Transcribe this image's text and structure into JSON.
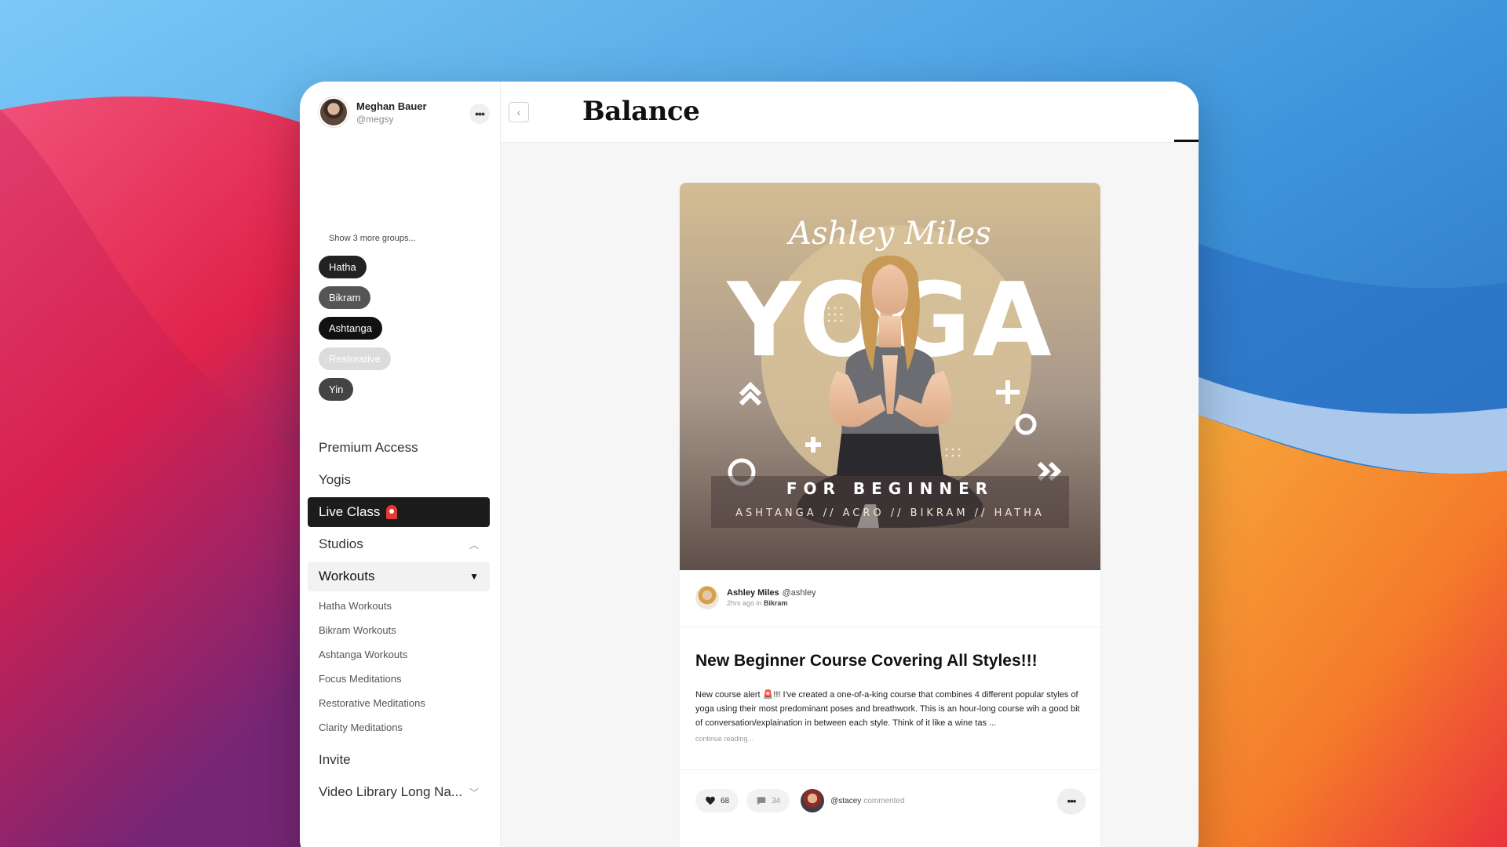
{
  "user": {
    "name": "Meghan Bauer",
    "handle": "@megsy"
  },
  "sidebar": {
    "more_label": "•••",
    "show_more_groups": "Show 3 more groups...",
    "groups": [
      "Hatha",
      "Bikram",
      "Ashtanga",
      "Restorative",
      "Yin"
    ],
    "nav": {
      "premium": "Premium Access",
      "yogis": "Yogis",
      "live_class": "Live Class",
      "studios": "Studios",
      "workouts": "Workouts",
      "sub_items": [
        "Hatha Workouts",
        "Bikram Workouts",
        "Ashtanga Workouts",
        "Focus Meditations",
        "Restorative Meditations",
        "Clarity Meditations"
      ],
      "invite": "Invite",
      "video_library": "Video Library Long Na..."
    }
  },
  "topbar": {
    "brand": "Balance",
    "icons": [
      "plus-circle-icon",
      "home-icon",
      "explore-icon",
      "notes-icon",
      "chat-icon",
      "user-avatar"
    ]
  },
  "post": {
    "image_text": {
      "script_name": "Ashley Miles",
      "headline": "YOGA",
      "subtitle": "FOR BEGINNER",
      "styles": "ASHTANGA  //  ACRO  //  BIKRAM  //  HATHA"
    },
    "author_name": "Ashley Miles",
    "author_handle": "@ashley",
    "time": "2hrs ago in",
    "group": "Bikram",
    "title": "New Beginner Course Covering All Styles!!!",
    "body": "New course alert 🚨!!! I've created a one-of-a-king course that combines 4 different popular styles of yoga using their most predominant poses and breathwork. This is an hour-long course wih a good bit of conversation/explaination in between each style. Think of it like a wine tas ...",
    "continue": "continue reading...",
    "likes": "68",
    "comments": "34",
    "commenter": "@stacey",
    "commented_label": "commented",
    "more_label": "•••"
  },
  "colors": {
    "active_nav": "#1c1c1c",
    "image_bg": "#cdb48a"
  }
}
